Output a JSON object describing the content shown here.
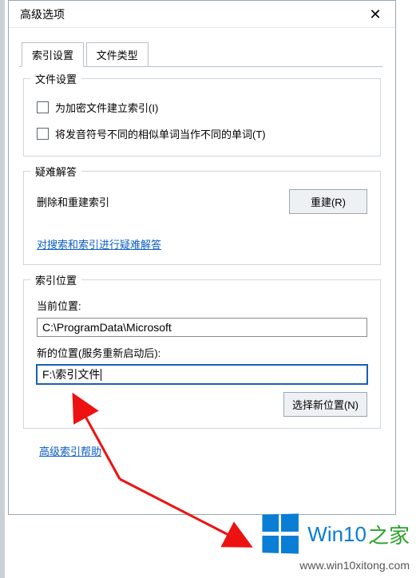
{
  "window": {
    "title": "高级选项"
  },
  "tabs": {
    "t0": "索引设置",
    "t1": "文件类型"
  },
  "file_settings": {
    "legend": "文件设置",
    "encrypt": "为加密文件建立索引(I)",
    "homophone": "将发音符号不同的相似单词当作不同的单词(T)"
  },
  "troubleshoot": {
    "legend": "疑难解答",
    "desc": "删除和重建索引",
    "rebuild_btn": "重建(R)",
    "ts_link": "对搜索和索引进行疑难解答"
  },
  "location": {
    "legend": "索引位置",
    "current_label": "当前位置:",
    "current_value": "C:\\ProgramData\\Microsoft",
    "new_label": "新的位置(服务重新启动后):",
    "new_value": "F:\\索引文件",
    "browse_btn": "选择新位置(N)"
  },
  "help_link": "高级索引帮助",
  "watermark": {
    "brand1": "Win10",
    "brand2": "之家",
    "url": "www.win10xitong.com"
  }
}
